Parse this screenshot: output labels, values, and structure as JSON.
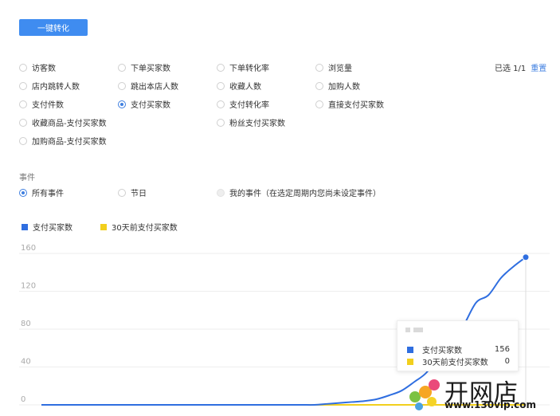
{
  "convert_button": "一键转化",
  "metrics": [
    {
      "label": "访客数",
      "checked": false
    },
    {
      "label": "下单买家数",
      "checked": false
    },
    {
      "label": "下单转化率",
      "checked": false
    },
    {
      "label": "浏览量",
      "checked": false
    },
    {
      "label": "店内跳转人数",
      "checked": false
    },
    {
      "label": "跳出本店人数",
      "checked": false
    },
    {
      "label": "收藏人数",
      "checked": false
    },
    {
      "label": "加购人数",
      "checked": false
    },
    {
      "label": "支付件数",
      "checked": false
    },
    {
      "label": "支付买家数",
      "checked": true
    },
    {
      "label": "支付转化率",
      "checked": false
    },
    {
      "label": "直接支付买家数",
      "checked": false
    },
    {
      "label": "收藏商品-支付买家数",
      "checked": false
    },
    {
      "label": "粉丝支付买家数",
      "checked": false
    },
    {
      "label": "加购商品-支付买家数",
      "checked": false
    }
  ],
  "selection": {
    "text": "已选 1/1",
    "reset": "重置"
  },
  "events": {
    "title": "事件",
    "options": [
      {
        "label": "所有事件",
        "checked": true,
        "disabled": false
      },
      {
        "label": "节日",
        "checked": false,
        "disabled": false
      },
      {
        "label": "我的事件（在选定周期内您尚未设定事件）",
        "checked": false,
        "disabled": true
      }
    ]
  },
  "colors": {
    "primary": "#3f8cf0",
    "series_current": "#2f6ee0",
    "series_prior": "#f2cf1d"
  },
  "chart_data": {
    "type": "line",
    "series": [
      {
        "name": "支付买家数",
        "color": "#2f6ee0",
        "values": [
          0,
          0,
          0,
          0,
          0,
          0,
          0,
          0,
          0,
          0,
          0,
          0,
          0,
          0,
          0,
          0,
          0,
          0,
          0,
          0,
          0,
          0,
          0,
          1,
          2,
          3,
          4,
          6,
          10,
          15,
          24,
          34,
          52,
          64,
          84,
          108,
          116,
          134,
          146,
          156
        ]
      },
      {
        "name": "30天前支付买家数",
        "color": "#f2cf1d",
        "values": [
          0,
          0,
          0,
          0,
          0,
          0,
          0,
          0,
          0,
          0,
          0,
          0,
          0,
          0,
          0,
          0,
          0,
          0,
          0,
          0,
          0,
          0,
          0,
          0,
          0,
          0,
          0,
          0,
          0,
          0,
          0,
          0,
          0,
          0,
          0,
          0,
          0,
          0,
          0,
          0
        ]
      }
    ],
    "y_ticks": [
      0,
      40,
      80,
      120,
      160
    ],
    "ylim": [
      0,
      160
    ],
    "grid": true,
    "legend_position": "top-left",
    "tooltip": {
      "rows": [
        {
          "name": "支付买家数",
          "value": 156
        },
        {
          "name": "30天前支付买家数",
          "value": 0
        }
      ]
    }
  },
  "watermark": {
    "brand": "开网店",
    "url": "www.130vip.com"
  }
}
